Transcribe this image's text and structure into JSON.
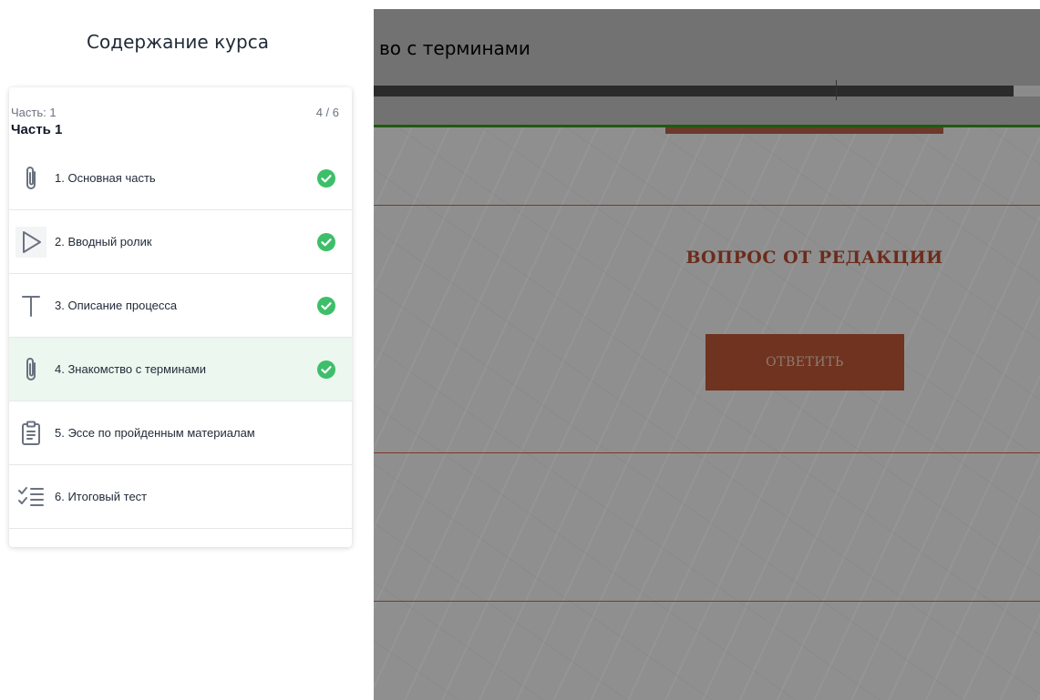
{
  "sidebar": {
    "title": "Содержание курса",
    "part": {
      "label": "Часть: 1",
      "counter": "4 / 6",
      "name": "Часть 1"
    },
    "lessons": [
      {
        "label": "1. Основная часть",
        "icon": "paperclip-icon",
        "completed": true,
        "active": false
      },
      {
        "label": "2. Вводный ролик",
        "icon": "play-icon",
        "completed": true,
        "active": false
      },
      {
        "label": "3. Описание процесса",
        "icon": "text-icon",
        "completed": true,
        "active": false
      },
      {
        "label": "4. Знакомство с терминами",
        "icon": "paperclip-icon",
        "completed": true,
        "active": true
      },
      {
        "label": "5. Эссе по пройденным материалам",
        "icon": "clipboard-icon",
        "completed": false,
        "active": false
      },
      {
        "label": "6. Итоговый тест",
        "icon": "checklist-icon",
        "completed": false,
        "active": false
      }
    ]
  },
  "content": {
    "lesson_title": "во с терминами",
    "progress_percent": 96,
    "question_heading": "ВОПРОС ОТ РЕДАКЦИИ",
    "answer_button": "ОТВЕТИТЬ"
  },
  "colors": {
    "check_green": "#3dbf6a",
    "active_row": "#ecf7ef",
    "overlay_gray": "#8e8e8e",
    "accent_orange_dimmed": "#6f3320"
  }
}
